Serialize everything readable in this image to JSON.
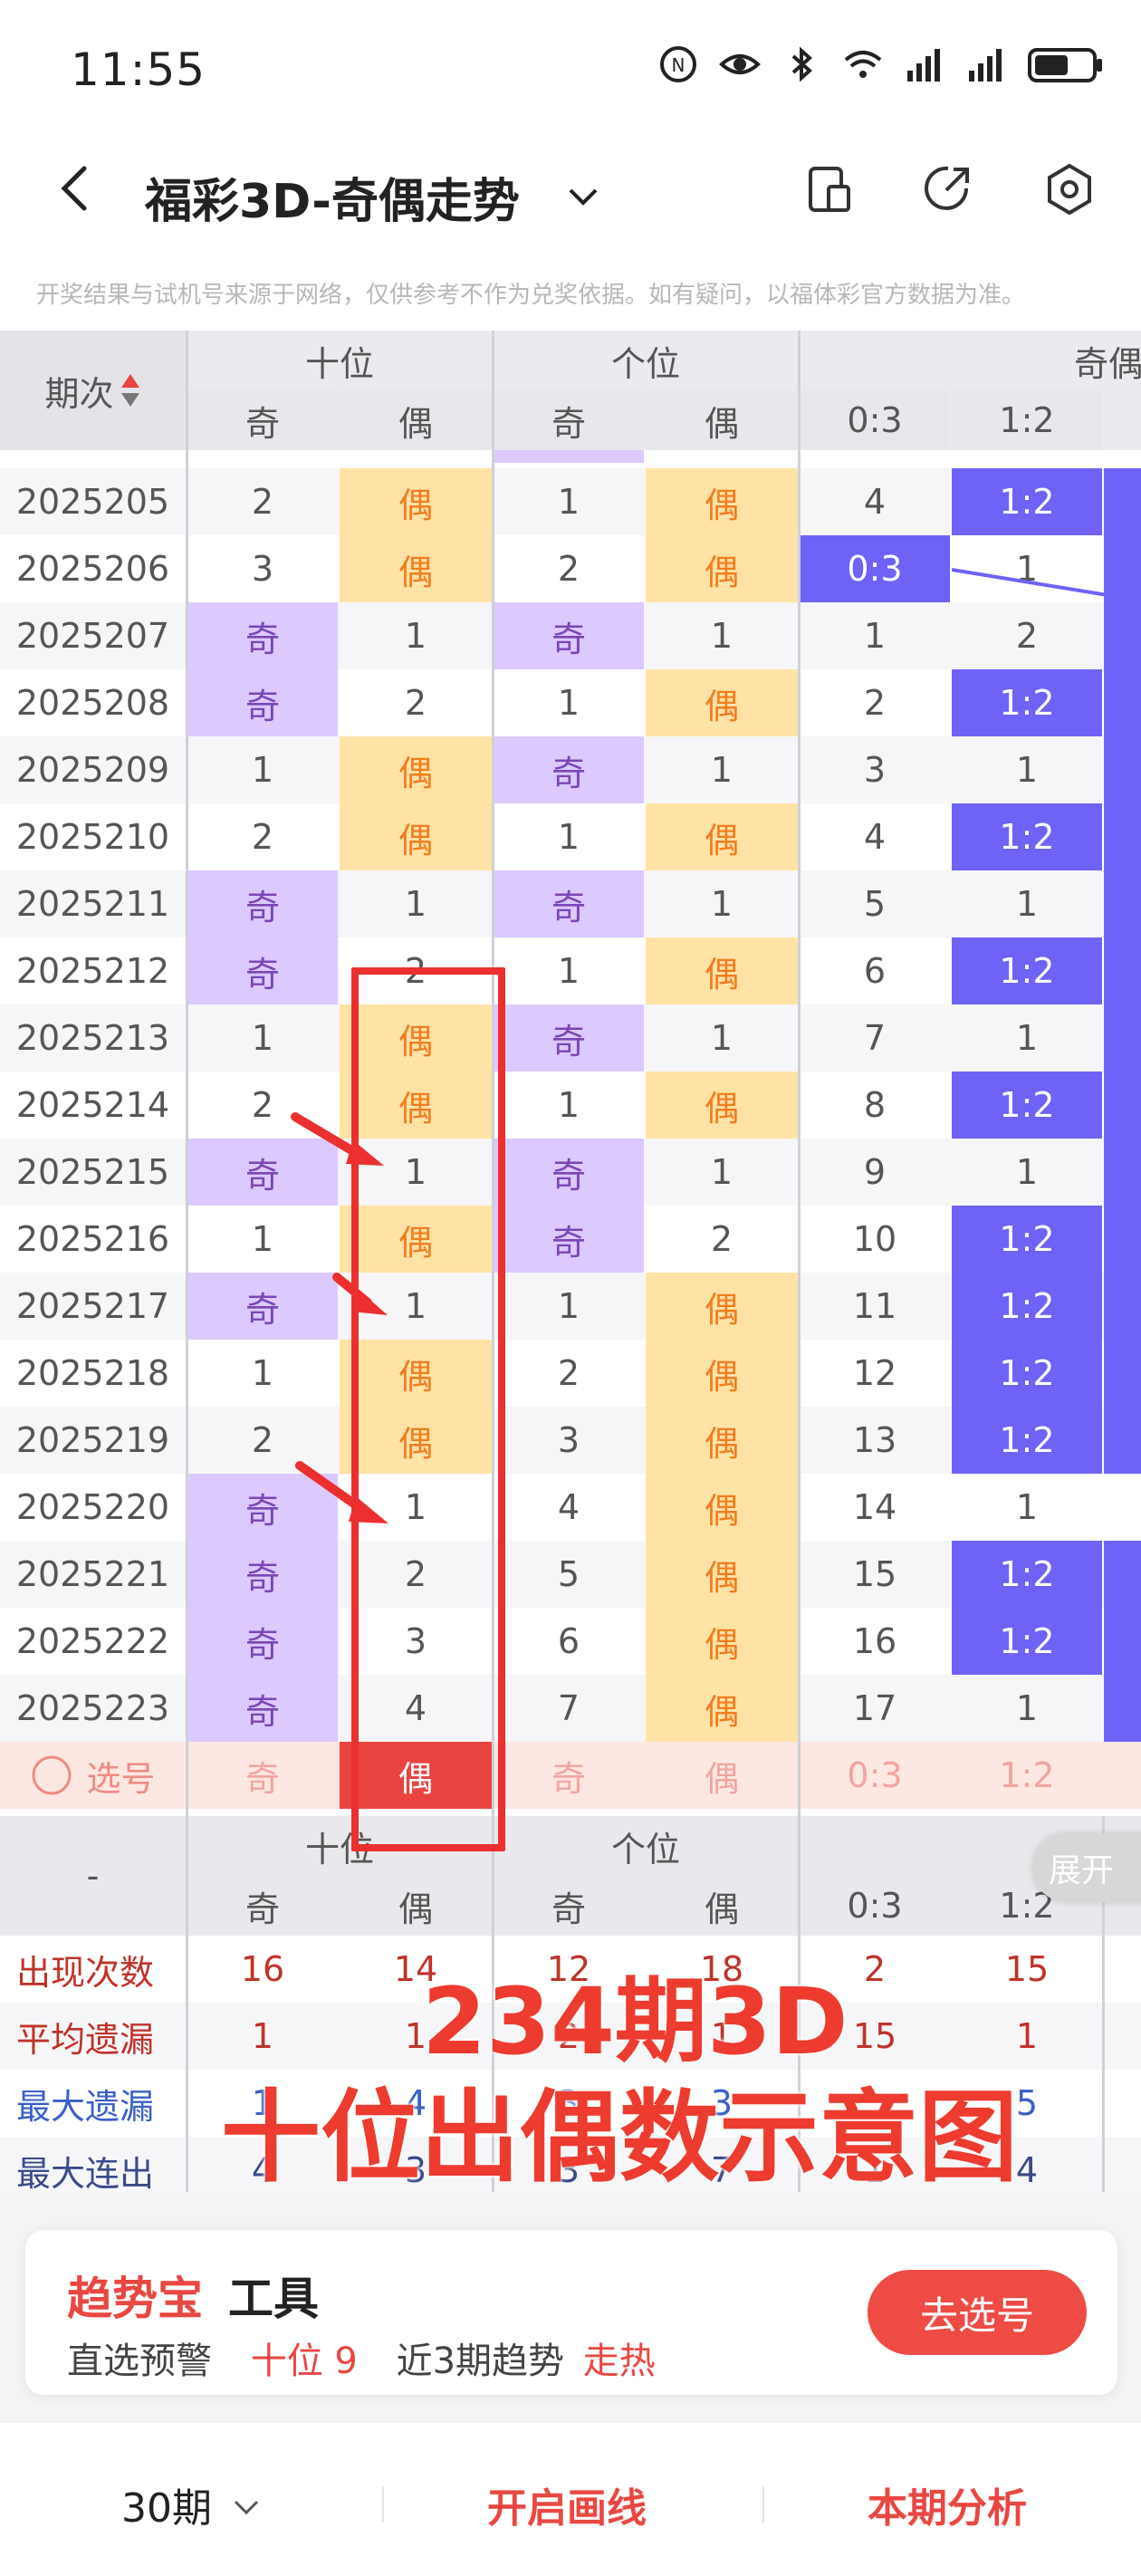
{
  "status_bar": {
    "time": "11:55"
  },
  "app_bar": {
    "title": "福彩3D-奇偶走势"
  },
  "disclaimer": "开奖结果与试机号来源于网络，仅供参考不作为兑奖依据。如有疑问，以福体彩官方数据为准。",
  "table": {
    "period_header": "期次",
    "groups": [
      "十位",
      "个位",
      "奇偶比"
    ],
    "sub_headers": [
      "奇",
      "偶",
      "奇",
      "偶",
      "0:3",
      "1:2"
    ],
    "rows": [
      {
        "period": "2025205",
        "cells": [
          "2",
          "偶",
          "1",
          "偶",
          "4",
          "1:2"
        ]
      },
      {
        "period": "2025206",
        "cells": [
          "3",
          "偶",
          "2",
          "偶",
          "0:3",
          "1"
        ]
      },
      {
        "period": "2025207",
        "cells": [
          "奇",
          "1",
          "奇",
          "1",
          "1",
          "2"
        ]
      },
      {
        "period": "2025208",
        "cells": [
          "奇",
          "2",
          "1",
          "偶",
          "2",
          "1:2"
        ]
      },
      {
        "period": "2025209",
        "cells": [
          "1",
          "偶",
          "奇",
          "1",
          "3",
          "1"
        ]
      },
      {
        "period": "2025210",
        "cells": [
          "2",
          "偶",
          "1",
          "偶",
          "4",
          "1:2"
        ]
      },
      {
        "period": "2025211",
        "cells": [
          "奇",
          "1",
          "奇",
          "1",
          "5",
          "1"
        ]
      },
      {
        "period": "2025212",
        "cells": [
          "奇",
          "2",
          "1",
          "偶",
          "6",
          "1:2"
        ]
      },
      {
        "period": "2025213",
        "cells": [
          "1",
          "偶",
          "奇",
          "1",
          "7",
          "1"
        ]
      },
      {
        "period": "2025214",
        "cells": [
          "2",
          "偶",
          "1",
          "偶",
          "8",
          "1:2"
        ]
      },
      {
        "period": "2025215",
        "cells": [
          "奇",
          "1",
          "奇",
          "1",
          "9",
          "1"
        ]
      },
      {
        "period": "2025216",
        "cells": [
          "1",
          "偶",
          "奇",
          "2",
          "10",
          "1:2"
        ]
      },
      {
        "period": "2025217",
        "cells": [
          "奇",
          "1",
          "1",
          "偶",
          "11",
          "1:2"
        ]
      },
      {
        "period": "2025218",
        "cells": [
          "1",
          "偶",
          "2",
          "偶",
          "12",
          "1:2"
        ]
      },
      {
        "period": "2025219",
        "cells": [
          "2",
          "偶",
          "3",
          "偶",
          "13",
          "1:2"
        ]
      },
      {
        "period": "2025220",
        "cells": [
          "奇",
          "1",
          "4",
          "偶",
          "14",
          "1"
        ]
      },
      {
        "period": "2025221",
        "cells": [
          "奇",
          "2",
          "5",
          "偶",
          "15",
          "1:2"
        ]
      },
      {
        "period": "2025222",
        "cells": [
          "奇",
          "3",
          "6",
          "偶",
          "16",
          "1:2"
        ]
      },
      {
        "period": "2025223",
        "cells": [
          "奇",
          "4",
          "7",
          "偶",
          "17",
          "1"
        ]
      }
    ],
    "select_row": {
      "label": "选号",
      "cells": [
        "奇",
        "偶",
        "奇",
        "偶",
        "0:3",
        "1:2"
      ]
    },
    "footer_group_label": "-",
    "footer_groups": [
      "十位",
      "个位"
    ],
    "stats": [
      {
        "label": "出现次数",
        "color": "#c0322a",
        "values": [
          "16",
          "14",
          "12",
          "18",
          "2",
          "15"
        ]
      },
      {
        "label": "平均遗漏",
        "color": "#c0322a",
        "values": [
          "1",
          "1",
          "2",
          "1",
          "15",
          "1"
        ]
      },
      {
        "label": "最大遗漏",
        "color": "#3a5fc8",
        "values": [
          "1",
          "4",
          "3",
          "3",
          "",
          "5"
        ]
      },
      {
        "label": "最大连出",
        "color": "#3a4a8a",
        "values": [
          "4",
          "3",
          "3",
          "7",
          "1",
          "4"
        ]
      }
    ],
    "expand_label": "展开"
  },
  "overlay": {
    "line1": "234期3D",
    "line2": "十位出偶数示意图"
  },
  "tool_card": {
    "title_red": "趋势宝",
    "title_black": "工具",
    "line_a": "直选预警",
    "line_b": "十位 9",
    "line_c": "近3期趋势",
    "line_d": "走热",
    "button": "去选号"
  },
  "bottom_nav": {
    "periods": "30期",
    "draw": "开启画线",
    "analysis": "本期分析"
  },
  "colors": {
    "purple": "#6f62f6",
    "lavender": "#dcc9ff",
    "peach": "#ffe3a6",
    "orange": "#f37d1f",
    "red": "#e94742"
  }
}
